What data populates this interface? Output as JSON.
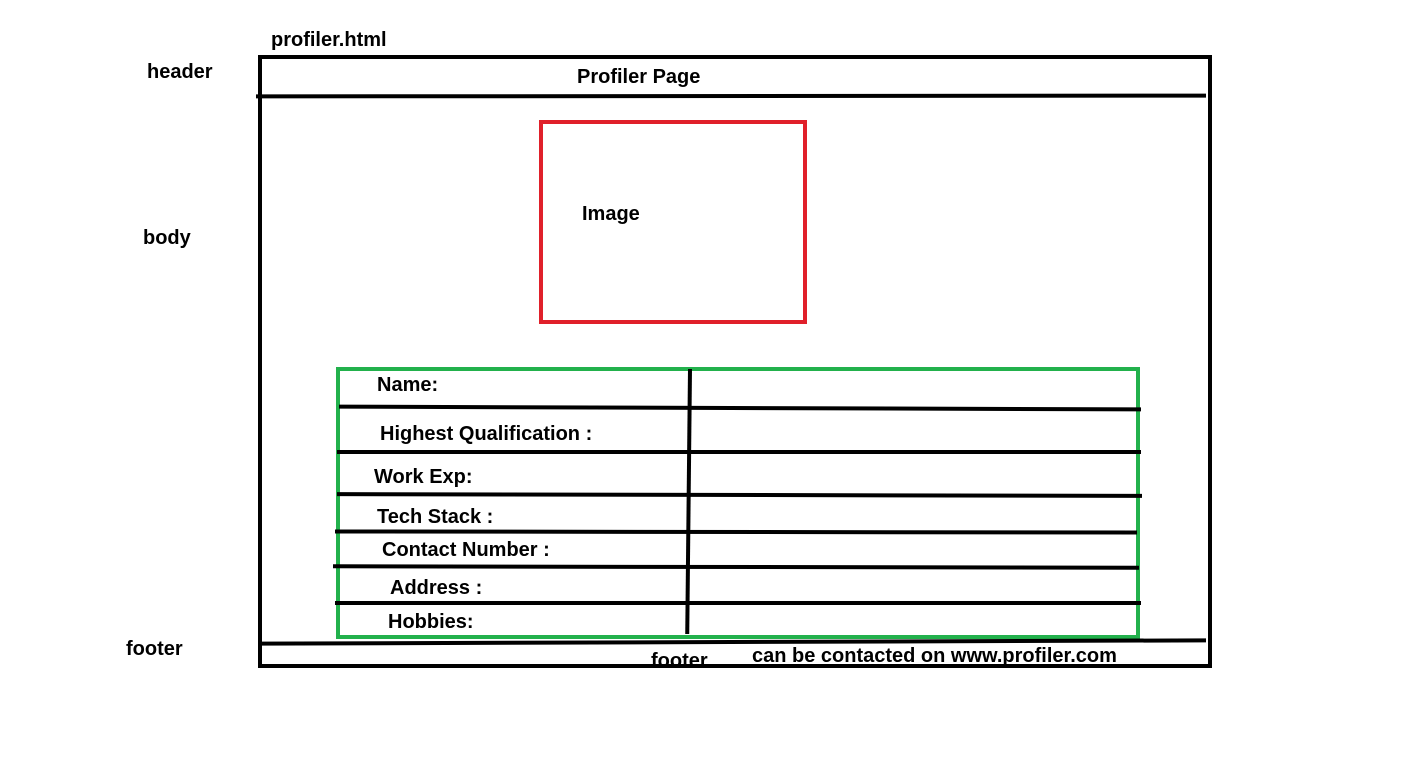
{
  "file_name": "profiler.html",
  "annotations": {
    "header": "header",
    "body": "body",
    "footer": "footer"
  },
  "header": {
    "title": "Profiler Page"
  },
  "image_placeholder": {
    "label": "Image"
  },
  "profile_table": {
    "rows": [
      "Name:",
      "Highest Qualification :",
      "Work Exp:",
      "Tech Stack :",
      "Contact Number :",
      "Address :",
      "Hobbies:"
    ]
  },
  "footer": {
    "label": "footer",
    "text": "can be contacted on www.profiler.com"
  },
  "colors": {
    "frame": "#000000",
    "image_border": "#e0202a",
    "table_border": "#22b14c"
  }
}
